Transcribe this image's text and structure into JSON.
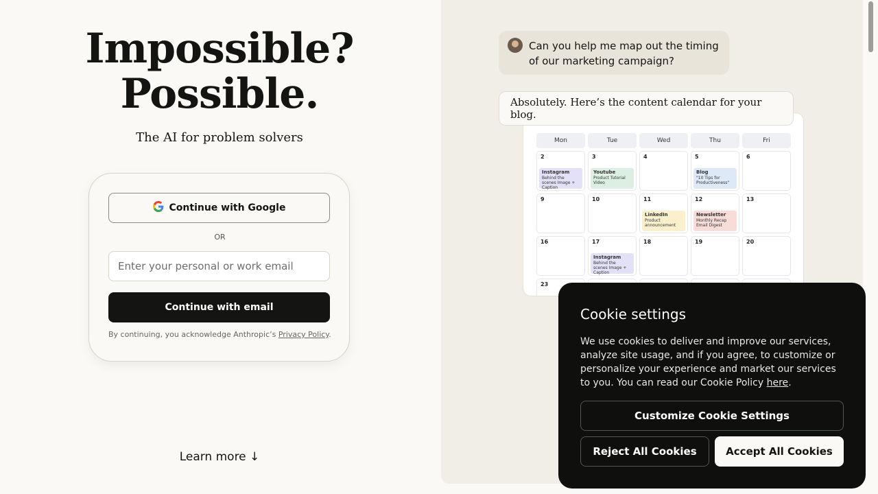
{
  "hero": {
    "title_line1": "Impossible?",
    "title_line2": "Possible.",
    "subtitle": "The AI for problem solvers"
  },
  "login": {
    "google_label": "Continue with Google",
    "or_label": "OR",
    "email_placeholder": "Enter your personal or work email",
    "email_button": "Continue with email",
    "legal_prefix": "By continuing, you acknowledge Anthropic’s ",
    "privacy_link": "Privacy Policy",
    "legal_suffix": "."
  },
  "learn_more": "Learn more ↓",
  "chat": {
    "user_message": "Can you help me map out the timing of our marketing campaign?",
    "ai_message": "Absolutely. Here’s the content calendar for your blog."
  },
  "calendar": {
    "days": [
      "Mon",
      "Tue",
      "Wed",
      "Thu",
      "Fri"
    ],
    "rows": [
      [
        {
          "num": "2",
          "event": {
            "title": "Instagram",
            "desc": "Behind the scenes Image + Caption",
            "kind": "insta"
          }
        },
        {
          "num": "3",
          "event": {
            "title": "Youtube",
            "desc": "Product Tutorial Video",
            "kind": "yt"
          }
        },
        {
          "num": "4"
        },
        {
          "num": "5",
          "event": {
            "title": "Blog",
            "desc": "\"10 Tips for Productiveness\"",
            "kind": "blog"
          }
        },
        {
          "num": "6"
        }
      ],
      [
        {
          "num": "9"
        },
        {
          "num": "10"
        },
        {
          "num": "11",
          "event": {
            "title": "LinkedIn",
            "desc": "Product announcement",
            "kind": "li"
          }
        },
        {
          "num": "12",
          "event": {
            "title": "Newsletter",
            "desc": "Monthly Recap Email Digest",
            "kind": "news"
          }
        },
        {
          "num": "13"
        }
      ],
      [
        {
          "num": "16"
        },
        {
          "num": "17",
          "event": {
            "title": "Instagram",
            "desc": "Behind the scenes Image + Caption",
            "kind": "insta"
          }
        },
        {
          "num": "18"
        },
        {
          "num": "19"
        },
        {
          "num": "20"
        }
      ],
      [
        {
          "num": "23"
        },
        {
          "num": ""
        },
        {
          "num": ""
        },
        {
          "num": ""
        },
        {
          "num": ""
        }
      ]
    ]
  },
  "cookie": {
    "title": "Cookie settings",
    "body": "We use cookies to deliver and improve our services, analyze site usage, and if you agree, to customize or personalize your experience and market our services to you. You can read our Cookie Policy ",
    "link": "here",
    "body_end": ".",
    "customize": "Customize Cookie Settings",
    "reject": "Reject All Cookies",
    "accept": "Accept All Cookies"
  }
}
